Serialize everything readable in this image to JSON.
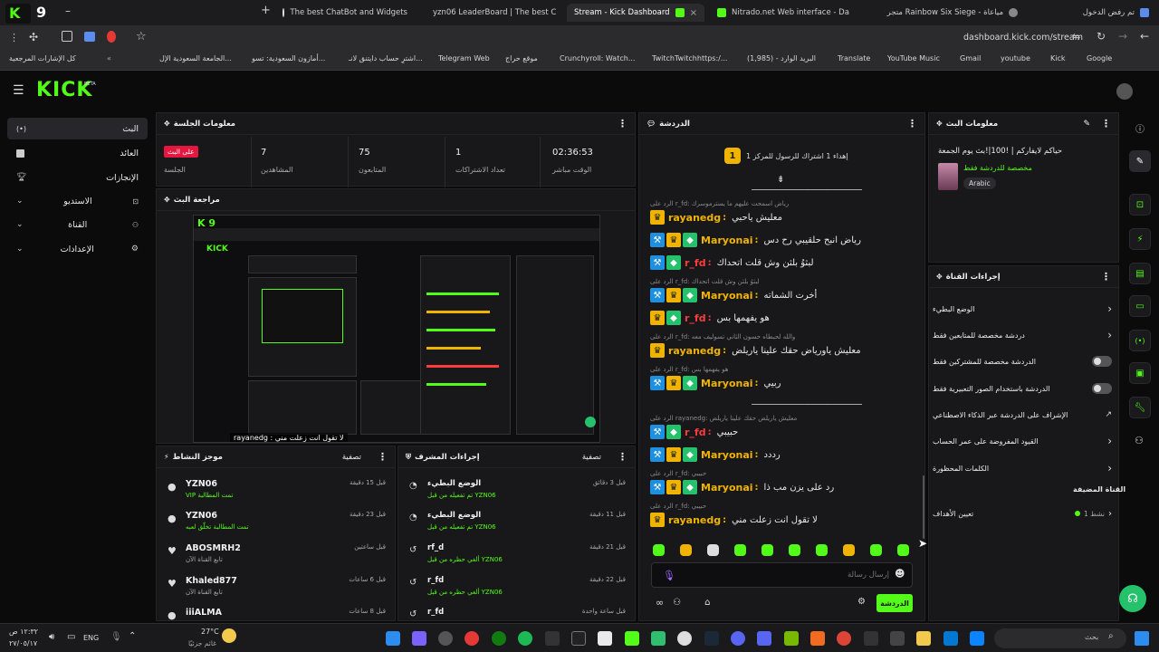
{
  "browser": {
    "tabs": [
      {
        "title": "تم رفض الدخول"
      },
      {
        "title": "متجر Rainbow Six Siege - مياعاة"
      },
      {
        "title": "Nitrado.net Web interface - Da"
      },
      {
        "title": "Stream - Kick Dashboard"
      },
      {
        "title": "yzn06 LeaderBoard | The best C"
      },
      {
        "title": "The best ChatBot and Widgets"
      }
    ],
    "url": "dashboard.kick.com/stream",
    "bookmarks": [
      "Google",
      "Kick",
      "youtube",
      "Gmail",
      "YouTube Music",
      "Translate",
      "البريد الوارد - (1,985)",
      "TwitchTwitchhttps:/...",
      "Crunchyroll: Watch...",
      "موقع حراج",
      "Telegram Web",
      "اشترِ حساب دايتنق لانـ...",
      "أمازون السعودية: تسو...",
      "الجامعة السعودية الإل...",
      "كل الإشارات المرجعية"
    ]
  },
  "header": {
    "logo": "KICK",
    "beta": "BETA"
  },
  "sidebar": {
    "items": [
      {
        "label": "البث"
      },
      {
        "label": "العائد"
      },
      {
        "label": "الإنجازات"
      },
      {
        "label": "الاستديو"
      },
      {
        "label": "القناة"
      },
      {
        "label": "الإعدادات"
      }
    ]
  },
  "session": {
    "title": "معلومات الجلسة",
    "live_badge": "على البث",
    "live_label": "الجلسة",
    "stats": [
      {
        "value": "7",
        "label": "المشاهدين"
      },
      {
        "value": "75",
        "label": "المتابعون"
      },
      {
        "value": "1",
        "label": "تعداد الاشتراكات"
      },
      {
        "value": "02:36:53",
        "label": "الوقت مباشر"
      }
    ]
  },
  "preview": {
    "title": "مراجعة البث",
    "overlay": "rayanedg : لا تقول انت زعلت مني"
  },
  "activity": {
    "title": "موجز النشاط",
    "filter": "تصفية",
    "items": [
      {
        "name": "YZN06",
        "sub": "VIP تمت المطالبة",
        "time": "قبل 15 دقيقة"
      },
      {
        "name": "YZN06",
        "sub": "تمت المطالبة تخلّق لعبه",
        "time": "قبل 23 دقيقة"
      },
      {
        "name": "ABOSMRH2",
        "sub": "تابع القناة الآن",
        "time": "قبل ساعتين"
      },
      {
        "name": "Khaled877",
        "sub": "تابع القناة الآن",
        "time": "قبل 6 ساعات"
      },
      {
        "name": "iiiALMA",
        "sub": "",
        "time": "قبل 8 ساعات"
      }
    ]
  },
  "modlog": {
    "title": "إجراءات المشرف",
    "filter": "تصفية",
    "items": [
      {
        "action": "الوضع البطيء",
        "by": "تم تفعيله من قبل YZN06",
        "time": "قبل 3 دقائق"
      },
      {
        "action": "الوضع البطيء",
        "by": "تم تفعيله من قبل YZN06",
        "time": "قبل 11 دقيقة"
      },
      {
        "action": "rf_d",
        "by": "ألغي حظره من قبل YZN06",
        "time": "قبل 21 دقيقة"
      },
      {
        "action": "r_fd",
        "by": "ألغي حظره من قبل YZN06",
        "time": "قبل 22 دقيقة"
      },
      {
        "action": "r_fd",
        "by": "",
        "time": "قبل ساعة واحدة"
      }
    ]
  },
  "chat": {
    "title": "الدردشة",
    "pinned": "إهداء 1 اشتراك للرسول للمركز 1",
    "pinned_rank": "1",
    "placeholder": "إرسال رسالة",
    "send": "الدردشة",
    "divider": "ــــــــــــــــــــــــــــــــــــــــــــــــــــ",
    "messages": [
      {
        "type": "divider"
      },
      {
        "type": "reply",
        "text": "الرد على r_fd: رياض اسمحت عليهم ما يسترموسرك"
      },
      {
        "type": "msg",
        "badges": [
          "gold"
        ],
        "user": "rayanedg",
        "color": "#f0b400",
        "text": "معليش ياحبي"
      },
      {
        "type": "msg",
        "badges": [
          "blue",
          "gold",
          "green"
        ],
        "user": "Maryonai",
        "color": "#f0b400",
        "text": "رياض انبح حلقيبي رح دس"
      },
      {
        "type": "msg",
        "badges": [
          "blue",
          "green"
        ],
        "user": "r_fd",
        "color": "#ff3b3b",
        "text": "لبثوُ بلثن وش قلت اتحداك"
      },
      {
        "type": "reply",
        "text": "الرد على r_fd: لبثوُ بلثن وش قلت اتحداك"
      },
      {
        "type": "msg",
        "badges": [
          "blue",
          "gold",
          "green"
        ],
        "user": "Maryonai",
        "color": "#f0b400",
        "text": "أخرت الشماته"
      },
      {
        "type": "msg",
        "badges": [
          "gold",
          "green"
        ],
        "user": "r_fd",
        "color": "#ff3b3b",
        "text": "هو يفهمها بس"
      },
      {
        "type": "reply",
        "text": "الرد على r_fd: والله لحبطاه حسون الثاني تسوليف معه"
      },
      {
        "type": "msg",
        "badges": [
          "gold"
        ],
        "user": "rayanedg",
        "color": "#f0b400",
        "text": "معليش ياورياض حقك علينا ياريلض"
      },
      {
        "type": "reply",
        "text": "الرد على r_fd: هو يفهمها بس"
      },
      {
        "type": "msg",
        "badges": [
          "blue",
          "gold",
          "green"
        ],
        "user": "Maryonai",
        "color": "#f0b400",
        "text": "ربيي"
      },
      {
        "type": "divider"
      },
      {
        "type": "reply",
        "text": "الرد على rayanedg: معليش ياريلض حقك علينا ياريلض"
      },
      {
        "type": "msg",
        "badges": [
          "blue",
          "green"
        ],
        "user": "r_fd",
        "color": "#ff3b3b",
        "text": "حبيبي"
      },
      {
        "type": "msg",
        "badges": [
          "blue",
          "gold",
          "green"
        ],
        "user": "Maryonai",
        "color": "#f0b400",
        "text": "رددد"
      },
      {
        "type": "reply",
        "text": "الرد على r_fd: حبيبي"
      },
      {
        "type": "msg",
        "badges": [
          "blue",
          "gold",
          "green"
        ],
        "user": "Maryonai",
        "color": "#f0b400",
        "text": "رد على يزن مب ذا"
      },
      {
        "type": "reply",
        "text": "الرد على r_fd: حبيبي"
      },
      {
        "type": "msg",
        "badges": [
          "gold"
        ],
        "user": "rayanedg",
        "color": "#f0b400",
        "text": "لا تقول انت زعلت مني"
      }
    ]
  },
  "stream_info": {
    "title": "معلومات البث",
    "name": "حياكم لايفاركم | !100|!بث يوم الجمعة",
    "category": "مخصصة للدردشة فقط",
    "language": "Arabic"
  },
  "channel_actions": {
    "title": "إجراءات القناة",
    "items": [
      {
        "label": "الوضع البطيء",
        "control": "chevron"
      },
      {
        "label": "دردشة مخصصة للمتابعين فقط",
        "control": "chevron"
      },
      {
        "label": "الدردشة مخصصة للمشتركين فقط",
        "control": "toggle"
      },
      {
        "label": "الدردشة باستخدام الصور التعبيرية فقط",
        "control": "toggle"
      },
      {
        "label": "الإشراف على الدردشة عبر الذكاء الاصطناعي",
        "control": "external"
      },
      {
        "label": "القيود المفروضة على عمر الحساب",
        "control": "chevron"
      },
      {
        "label": "الكلمات المحظورة",
        "control": "chevron"
      }
    ],
    "featured_title": "القناة المضيفة",
    "goals_label": "تعيين الأهداف",
    "goals_count": "نشط 1"
  },
  "taskbar": {
    "time": "١٢:٣٢ ص",
    "date": "٢٧/٠٥/١٧",
    "lang": "ENG",
    "weather_temp": "27°C",
    "weather_desc": "غائم جزئيًا",
    "search": "بحث"
  }
}
